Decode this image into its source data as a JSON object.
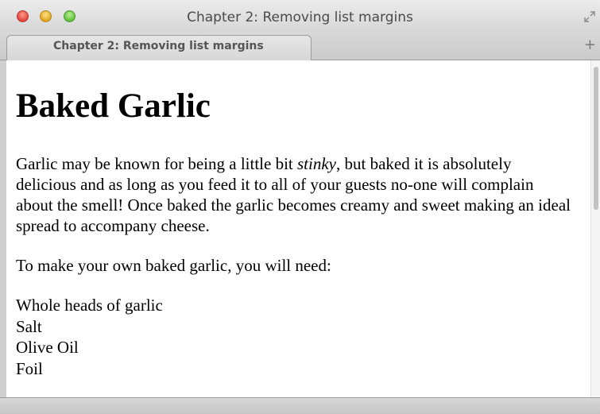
{
  "window": {
    "title": "Chapter 2: Removing list margins"
  },
  "tabbar": {
    "active_tab_label": "Chapter 2: Removing list margins",
    "new_tab_label": "+"
  },
  "page": {
    "heading": "Baked Garlic",
    "intro_before": "Garlic may be known for being a little bit ",
    "intro_emphasis": "stinky",
    "intro_after": ", but baked it is absolutely delicious and as long as you feed it to all of your guests no-one will complain about the smell! Once baked the garlic becomes creamy and sweet making an ideal spread to accompany cheese.",
    "need": "To make your own baked garlic, you will need:",
    "ingredients": [
      "Whole heads of garlic",
      "Salt",
      "Olive Oil",
      "Foil"
    ]
  }
}
